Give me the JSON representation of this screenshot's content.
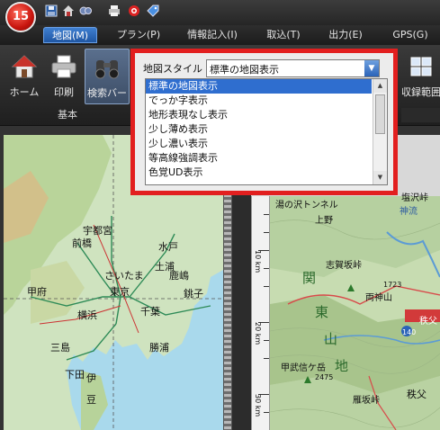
{
  "app": {
    "logo_text": "15"
  },
  "quick_access": [
    {
      "name": "save-icon"
    },
    {
      "name": "home-icon"
    },
    {
      "name": "search-tool-icon"
    },
    {
      "name": "print-icon"
    },
    {
      "name": "target-icon"
    },
    {
      "name": "tag-icon"
    }
  ],
  "menu": {
    "tabs": [
      {
        "label": "地図(M)",
        "active": true
      },
      {
        "label": "プラン(P)"
      },
      {
        "label": "情報記入(I)"
      },
      {
        "label": "取込(T)"
      },
      {
        "label": "出力(E)"
      },
      {
        "label": "GPS(G)"
      }
    ]
  },
  "ribbon": {
    "buttons": [
      {
        "label": "ホーム",
        "icon": "home-icon"
      },
      {
        "label": "印刷",
        "icon": "printer-icon"
      },
      {
        "label": "検索バー",
        "icon": "binoculars-icon"
      },
      {
        "label": "収録範囲",
        "icon": "grid-icon"
      }
    ],
    "group_label": "基本"
  },
  "map_style_dropdown": {
    "label": "地図スタイル",
    "selected_value": "標準の地図表示",
    "options": [
      {
        "label": "標準の地図表示",
        "selected": true
      },
      {
        "label": "でっか字表示"
      },
      {
        "label": "地形表現なし表示"
      },
      {
        "label": "少し薄め表示"
      },
      {
        "label": "少し濃い表示"
      },
      {
        "label": "等高線強調表示"
      },
      {
        "label": "色覚UD表示"
      }
    ],
    "highlight_color": "#e21f1f"
  },
  "left_map": {
    "labels": [
      "宇都宮",
      "前橋",
      "水戸",
      "さいたま",
      "土浦",
      "甲府",
      "東京",
      "千葉",
      "横浜",
      "鹿嶋",
      "銚子",
      "三島",
      "勝浦",
      "下田",
      "伊",
      "豆"
    ]
  },
  "right_map": {
    "labels": [
      "湯の沢トンネル",
      "塩沢峠",
      "上野",
      "神流",
      "関",
      "志賀坂峠",
      "1723",
      "両神山",
      "東",
      "秩父",
      "山",
      "地",
      "甲武信ケ岳",
      "2475",
      "雁坂峠",
      "秩父",
      "140"
    ]
  },
  "ruler": {
    "labels": [
      "10 km",
      "20 km",
      "30 km"
    ]
  },
  "colors": {
    "menu_active": "#2f6ecf",
    "selection": "#2f6ecf",
    "sea": "#a8d8ea",
    "land": "#cfe3c0"
  }
}
